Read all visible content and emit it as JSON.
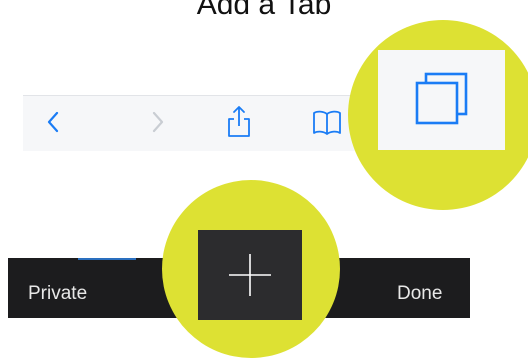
{
  "page": {
    "title": "Add a Tab"
  },
  "toolbar": {
    "icons": {
      "back": "chevron-left-icon",
      "forward": "chevron-right-icon",
      "share": "share-icon",
      "bookmarks": "book-icon",
      "tabs": "tabs-icon"
    },
    "accent_color": "#1a7cf5"
  },
  "tab_switcher": {
    "private_label": "Private",
    "done_label": "Done",
    "add_icon": "plus-icon"
  },
  "highlight_color": "#dde133"
}
